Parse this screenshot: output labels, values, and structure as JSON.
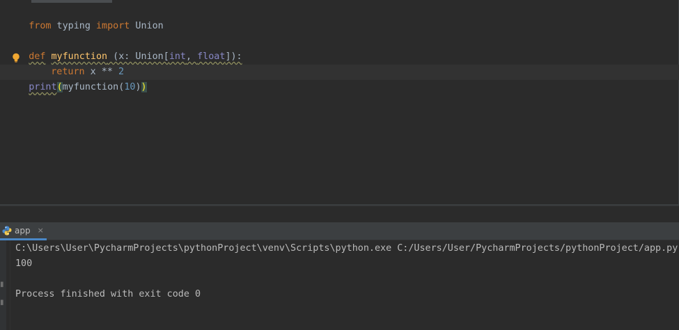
{
  "editor": {
    "line1": {
      "kw_from": "from",
      "module": " typing ",
      "kw_import": "import",
      "name": " Union"
    },
    "line3": {
      "kw_def": "def",
      "space1": " ",
      "func_name": "myfunction",
      "signature_a": " (x: Union[",
      "type_int": "int",
      "comma": ", ",
      "type_float": "float",
      "signature_b": "]):"
    },
    "line4": {
      "kw_return": "return",
      "expr": " x ** ",
      "num": "2"
    },
    "line5": {
      "builtin_print": "print",
      "open_paren": "(",
      "call": "myfunction(",
      "arg": "10",
      "close_inner": ")",
      "close_paren": ")"
    }
  },
  "run_window": {
    "tab_label": "app",
    "close_glyph": "×",
    "console": {
      "command": "C:\\Users\\User\\PycharmProjects\\pythonProject\\venv\\Scripts\\python.exe C:/Users/User/PycharmProjects/pythonProject/app.py",
      "output": "100",
      "exit_message": "Process finished with exit code 0"
    }
  },
  "colors": {
    "keyword": "#cc7832",
    "function_def": "#ffc66d",
    "builtin": "#8888c6",
    "number": "#6897bb",
    "text": "#a9b7c6",
    "background": "#2b2b2b",
    "accent": "#4a88c7"
  },
  "icons": {
    "intention": "lightbulb-icon",
    "run_config": "python-icon",
    "close": "close-icon"
  }
}
